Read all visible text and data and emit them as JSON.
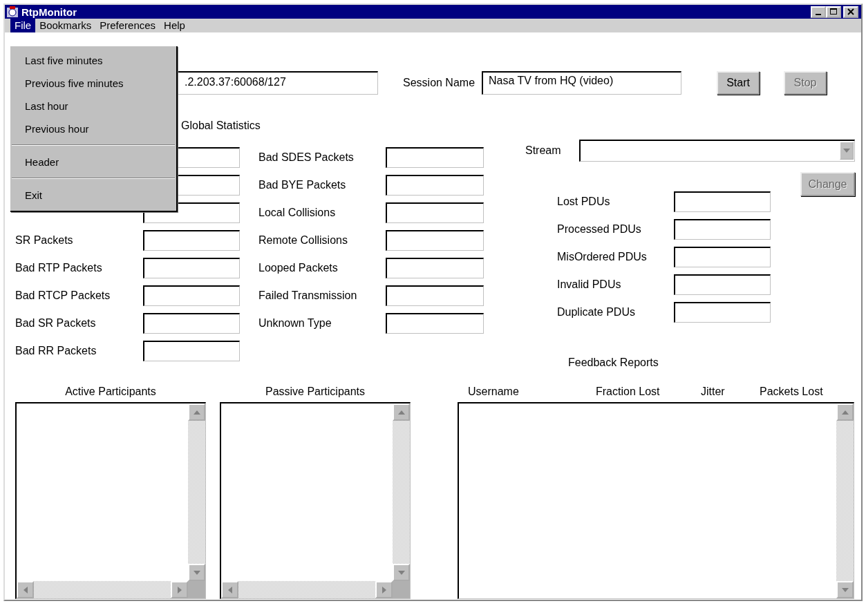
{
  "window": {
    "title": "RtpMonitor"
  },
  "menu_bar": [
    {
      "label": "File",
      "selected": true
    },
    {
      "label": "Bookmarks",
      "selected": false
    },
    {
      "label": "Preferences",
      "selected": false
    },
    {
      "label": "Help",
      "selected": false
    }
  ],
  "file_menu": {
    "groups": [
      [
        "Last five minutes",
        "Previous five minutes",
        "Last hour",
        "Previous hour"
      ],
      [
        "Header"
      ],
      [
        "Exit"
      ]
    ]
  },
  "address_field": {
    "value": ".2.203.37:60068/127"
  },
  "session": {
    "label": "Session Name",
    "value": "Nasa TV from HQ (video)"
  },
  "buttons": [
    {
      "label": "Start",
      "disabled": false
    },
    {
      "label": "Stop",
      "disabled": true
    }
  ],
  "global_statistics": {
    "title": "Global Statistics",
    "column_1": [
      {
        "kind": "unlabeled"
      },
      {
        "kind": "unlabeled"
      },
      {
        "kind": "unlabeled"
      },
      {
        "kind": "labeled",
        "label": "SR Packets"
      },
      {
        "kind": "labeled",
        "label": "Bad RTP Packets"
      },
      {
        "kind": "labeled",
        "label": "Bad RTCP Packets"
      },
      {
        "kind": "labeled",
        "label": "Bad SR Packets"
      },
      {
        "kind": "labeled",
        "label": "Bad RR Packets"
      }
    ],
    "column_2": [
      {
        "label": "Bad SDES Packets"
      },
      {
        "label": "Bad BYE Packets"
      },
      {
        "label": "Local Collisions"
      },
      {
        "label": "Remote Collisions"
      },
      {
        "label": "Looped Packets"
      },
      {
        "label": "Failed Transmission"
      },
      {
        "label": "Unknown Type"
      }
    ]
  },
  "stream": {
    "label": "Stream",
    "change_button": {
      "label": "Change",
      "disabled": true
    },
    "stats": [
      {
        "label": "Lost PDUs"
      },
      {
        "label": "Processed PDUs"
      },
      {
        "label": "MisOrdered PDUs"
      },
      {
        "label": "Invalid PDUs"
      },
      {
        "label": "Duplicate PDUs"
      }
    ]
  },
  "participant_lists": [
    {
      "title": "Active Participants"
    },
    {
      "title": "Passive Participants"
    }
  ],
  "feedback_reports": {
    "title": "Feedback Reports",
    "columns": [
      "Username",
      "Fraction Lost",
      "Jitter",
      "Packets Lost"
    ]
  }
}
